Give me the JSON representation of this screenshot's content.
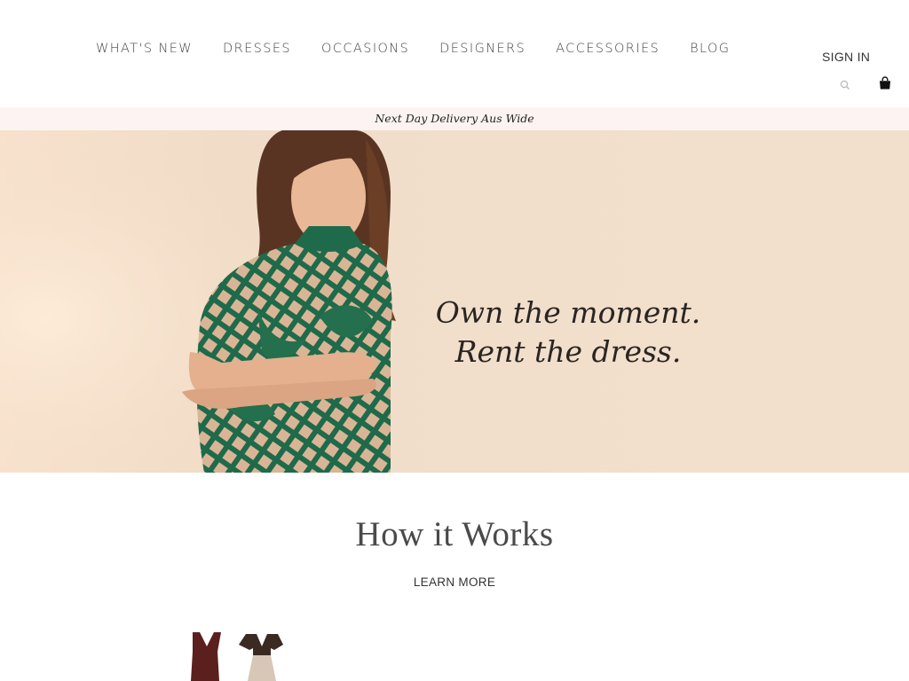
{
  "header": {
    "nav": [
      {
        "label": "WHAT'S NEW"
      },
      {
        "label": "DRESSES"
      },
      {
        "label": "OCCASIONS"
      },
      {
        "label": "DESIGNERS"
      },
      {
        "label": "ACCESSORIES"
      },
      {
        "label": "BLOG"
      }
    ],
    "sign_in_label": "SIGN IN",
    "search_icon": "search-icon",
    "bag_icon": "shopping-bag-icon"
  },
  "promo": {
    "text": "Next Day Delivery Aus Wide",
    "background": "#fdf3f2"
  },
  "hero": {
    "tagline_line1": "Own the moment.",
    "tagline_line2": "Rent the dress.",
    "dress_color": "#1f6a4a",
    "background": "#f1dfcb"
  },
  "how_it_works": {
    "title": "How it Works",
    "link_label": "LEARN MORE"
  }
}
